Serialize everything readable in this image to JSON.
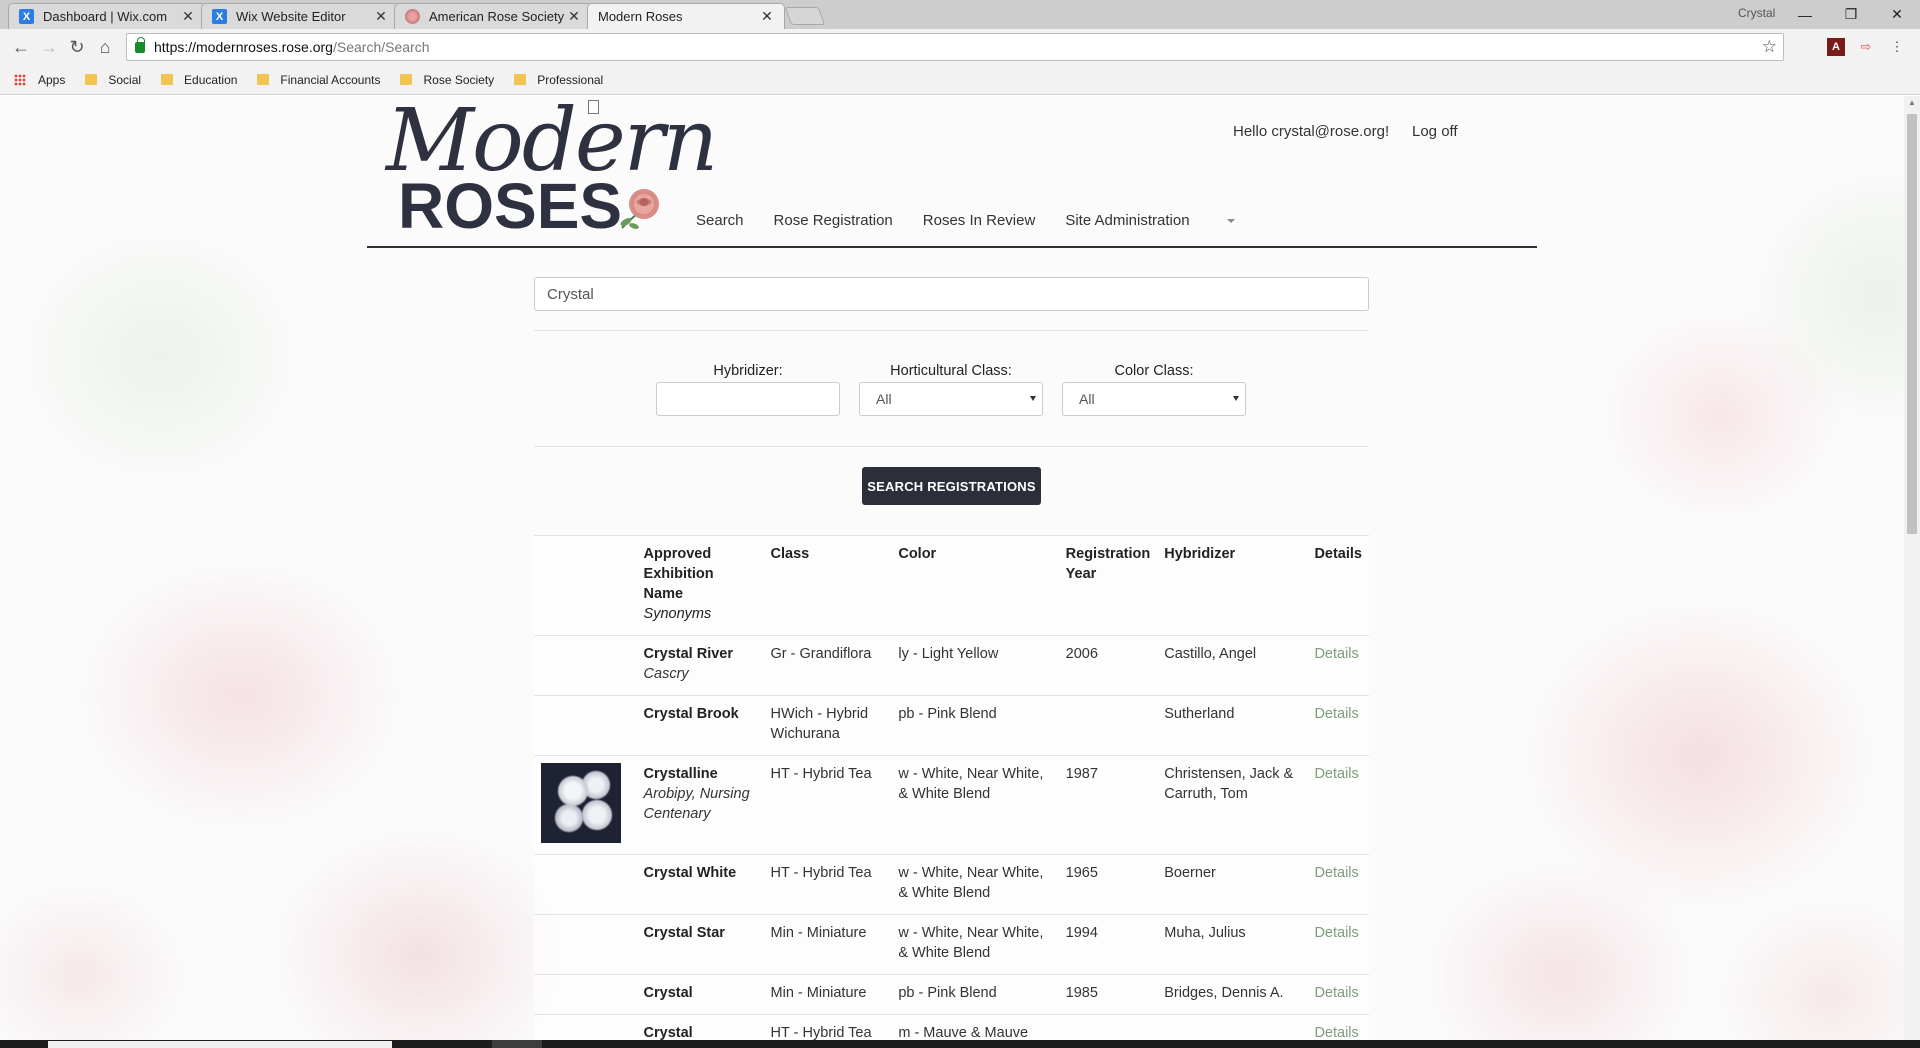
{
  "browser": {
    "tabs": [
      {
        "title": "Dashboard | Wix.com",
        "favicon": "wix-icon",
        "active": false
      },
      {
        "title": "Wix Website Editor",
        "favicon": "wix-icon",
        "active": false
      },
      {
        "title": "American Rose Society",
        "favicon": "rose-icon",
        "active": false
      },
      {
        "title": "Modern Roses",
        "favicon": "page-icon",
        "active": true
      }
    ],
    "profile_name": "Crystal",
    "url_host": "https://modernroses.rose.org",
    "url_path": "/Search/Search",
    "bookmarks": [
      "Apps",
      "Social",
      "Education",
      "Financial Accounts",
      "Rose Society",
      "Professional"
    ]
  },
  "site": {
    "logo_script": "Modern",
    "logo_bold": "ROSES",
    "greeting": "Hello crystal@rose.org!",
    "logoff": "Log off",
    "nav": [
      "Search",
      "Rose Registration",
      "Roses In Review",
      "Site Administration"
    ]
  },
  "search": {
    "query": "Crystal",
    "filters": {
      "hybridizer_label": "Hybridizer:",
      "hybridizer_value": "",
      "hort_class_label": "Horticultural Class:",
      "hort_class_value": "All",
      "color_class_label": "Color Class:",
      "color_class_value": "All"
    },
    "button": "SEARCH REGISTRATIONS"
  },
  "table": {
    "headers": {
      "name": "Approved Exhibition Name",
      "synonyms": "Synonyms",
      "class": "Class",
      "color": "Color",
      "year": "Registration Year",
      "hybridizer": "Hybridizer",
      "details": "Details"
    },
    "rows": [
      {
        "has_image": false,
        "name": "Crystal River",
        "synonyms": "Cascry",
        "class": "Gr - Grandiflora",
        "color": "ly - Light Yellow",
        "year": "2006",
        "hybridizer": "Castillo, Angel",
        "details": "Details"
      },
      {
        "has_image": false,
        "name": "Crystal Brook",
        "synonyms": "",
        "class": "HWich - Hybrid Wichurana",
        "color": "pb - Pink Blend",
        "year": "",
        "hybridizer": "Sutherland",
        "details": "Details"
      },
      {
        "has_image": true,
        "name": "Crystalline",
        "synonyms": "Arobipy, Nursing Centenary",
        "class": "HT - Hybrid Tea",
        "color": "w - White, Near White, & White Blend",
        "year": "1987",
        "hybridizer": "Christensen, Jack & Carruth, Tom",
        "details": "Details"
      },
      {
        "has_image": false,
        "name": "Crystal White",
        "synonyms": "",
        "class": "HT - Hybrid Tea",
        "color": "w - White, Near White, & White Blend",
        "year": "1965",
        "hybridizer": "Boerner",
        "details": "Details"
      },
      {
        "has_image": false,
        "name": "Crystal Star",
        "synonyms": "",
        "class": "Min - Miniature",
        "color": "w - White, Near White, & White Blend",
        "year": "1994",
        "hybridizer": "Muha, Julius",
        "details": "Details"
      },
      {
        "has_image": false,
        "name": "Crystal",
        "synonyms": "",
        "class": "Min - Miniature",
        "color": "pb - Pink Blend",
        "year": "1985",
        "hybridizer": "Bridges, Dennis A.",
        "details": "Details"
      },
      {
        "has_image": false,
        "name": "Crystal Lavender",
        "synonyms": "",
        "class": "HT - Hybrid Tea",
        "color": "m - Mauve & Mauve Blend",
        "year": "",
        "hybridizer": "",
        "details": "Details"
      }
    ]
  },
  "colors": {
    "brand_dark": "#2c2f3a",
    "details_link": "#7d9d7a"
  }
}
